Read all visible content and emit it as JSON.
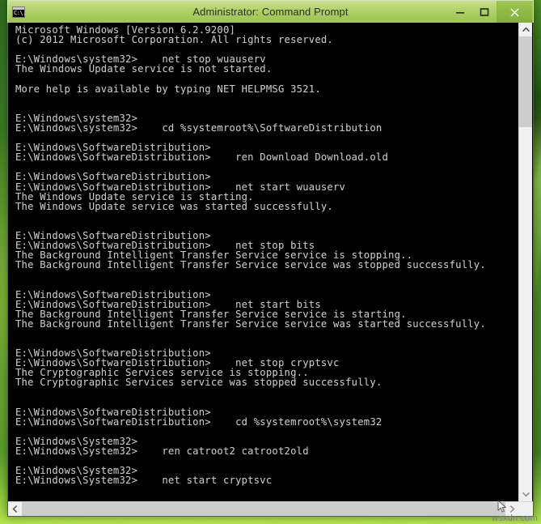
{
  "window": {
    "title": "Administrator: Command Prompt",
    "icon_name": "cmd-icon",
    "icon_glyph": "C:\\.",
    "minimize_label": "Minimize",
    "maximize_label": "Maximize",
    "close_label": "Close",
    "titlebar_color": "#b5d46c",
    "close_button_color": "#8cb843",
    "console_bg": "#000000",
    "console_fg": "#c8c8c8"
  },
  "desktop": {
    "wallpaper_accent": "#8fc63d"
  },
  "console": {
    "lines": [
      "Microsoft Windows [Version 6.2.9200]",
      "(c) 2012 Microsoft Corporation. All rights reserved.",
      "",
      "E:\\Windows\\system32>    net stop wuauserv",
      "The Windows Update service is not started.",
      "",
      "More help is available by typing NET HELPMSG 3521.",
      "",
      "",
      "E:\\Windows\\system32>",
      "E:\\Windows\\system32>    cd %systemroot%\\SoftwareDistribution",
      "",
      "E:\\Windows\\SoftwareDistribution>",
      "E:\\Windows\\SoftwareDistribution>    ren Download Download.old",
      "",
      "E:\\Windows\\SoftwareDistribution>",
      "E:\\Windows\\SoftwareDistribution>    net start wuauserv",
      "The Windows Update service is starting.",
      "The Windows Update service was started successfully.",
      "",
      "",
      "E:\\Windows\\SoftwareDistribution>",
      "E:\\Windows\\SoftwareDistribution>    net stop bits",
      "The Background Intelligent Transfer Service service is stopping..",
      "The Background Intelligent Transfer Service service was stopped successfully.",
      "",
      "",
      "E:\\Windows\\SoftwareDistribution>",
      "E:\\Windows\\SoftwareDistribution>    net start bits",
      "The Background Intelligent Transfer Service service is starting.",
      "The Background Intelligent Transfer Service service was started successfully.",
      "",
      "",
      "E:\\Windows\\SoftwareDistribution>",
      "E:\\Windows\\SoftwareDistribution>    net stop cryptsvc",
      "The Cryptographic Services service is stopping..",
      "The Cryptographic Services service was stopped successfully.",
      "",
      "",
      "E:\\Windows\\SoftwareDistribution>",
      "E:\\Windows\\SoftwareDistribution>    cd %systemroot%\\system32",
      "",
      "E:\\Windows\\System32>",
      "E:\\Windows\\System32>    ren catroot2 catroot2old",
      "",
      "E:\\Windows\\System32>",
      "E:\\Windows\\System32>    net start cryptsvc",
      ""
    ]
  },
  "scrollbars": {
    "vertical_up_label": "Scroll up",
    "vertical_down_label": "Scroll down",
    "horizontal_left_label": "Scroll left",
    "horizontal_right_label": "Scroll right"
  },
  "watermark": {
    "text": "wsxdn.com"
  }
}
